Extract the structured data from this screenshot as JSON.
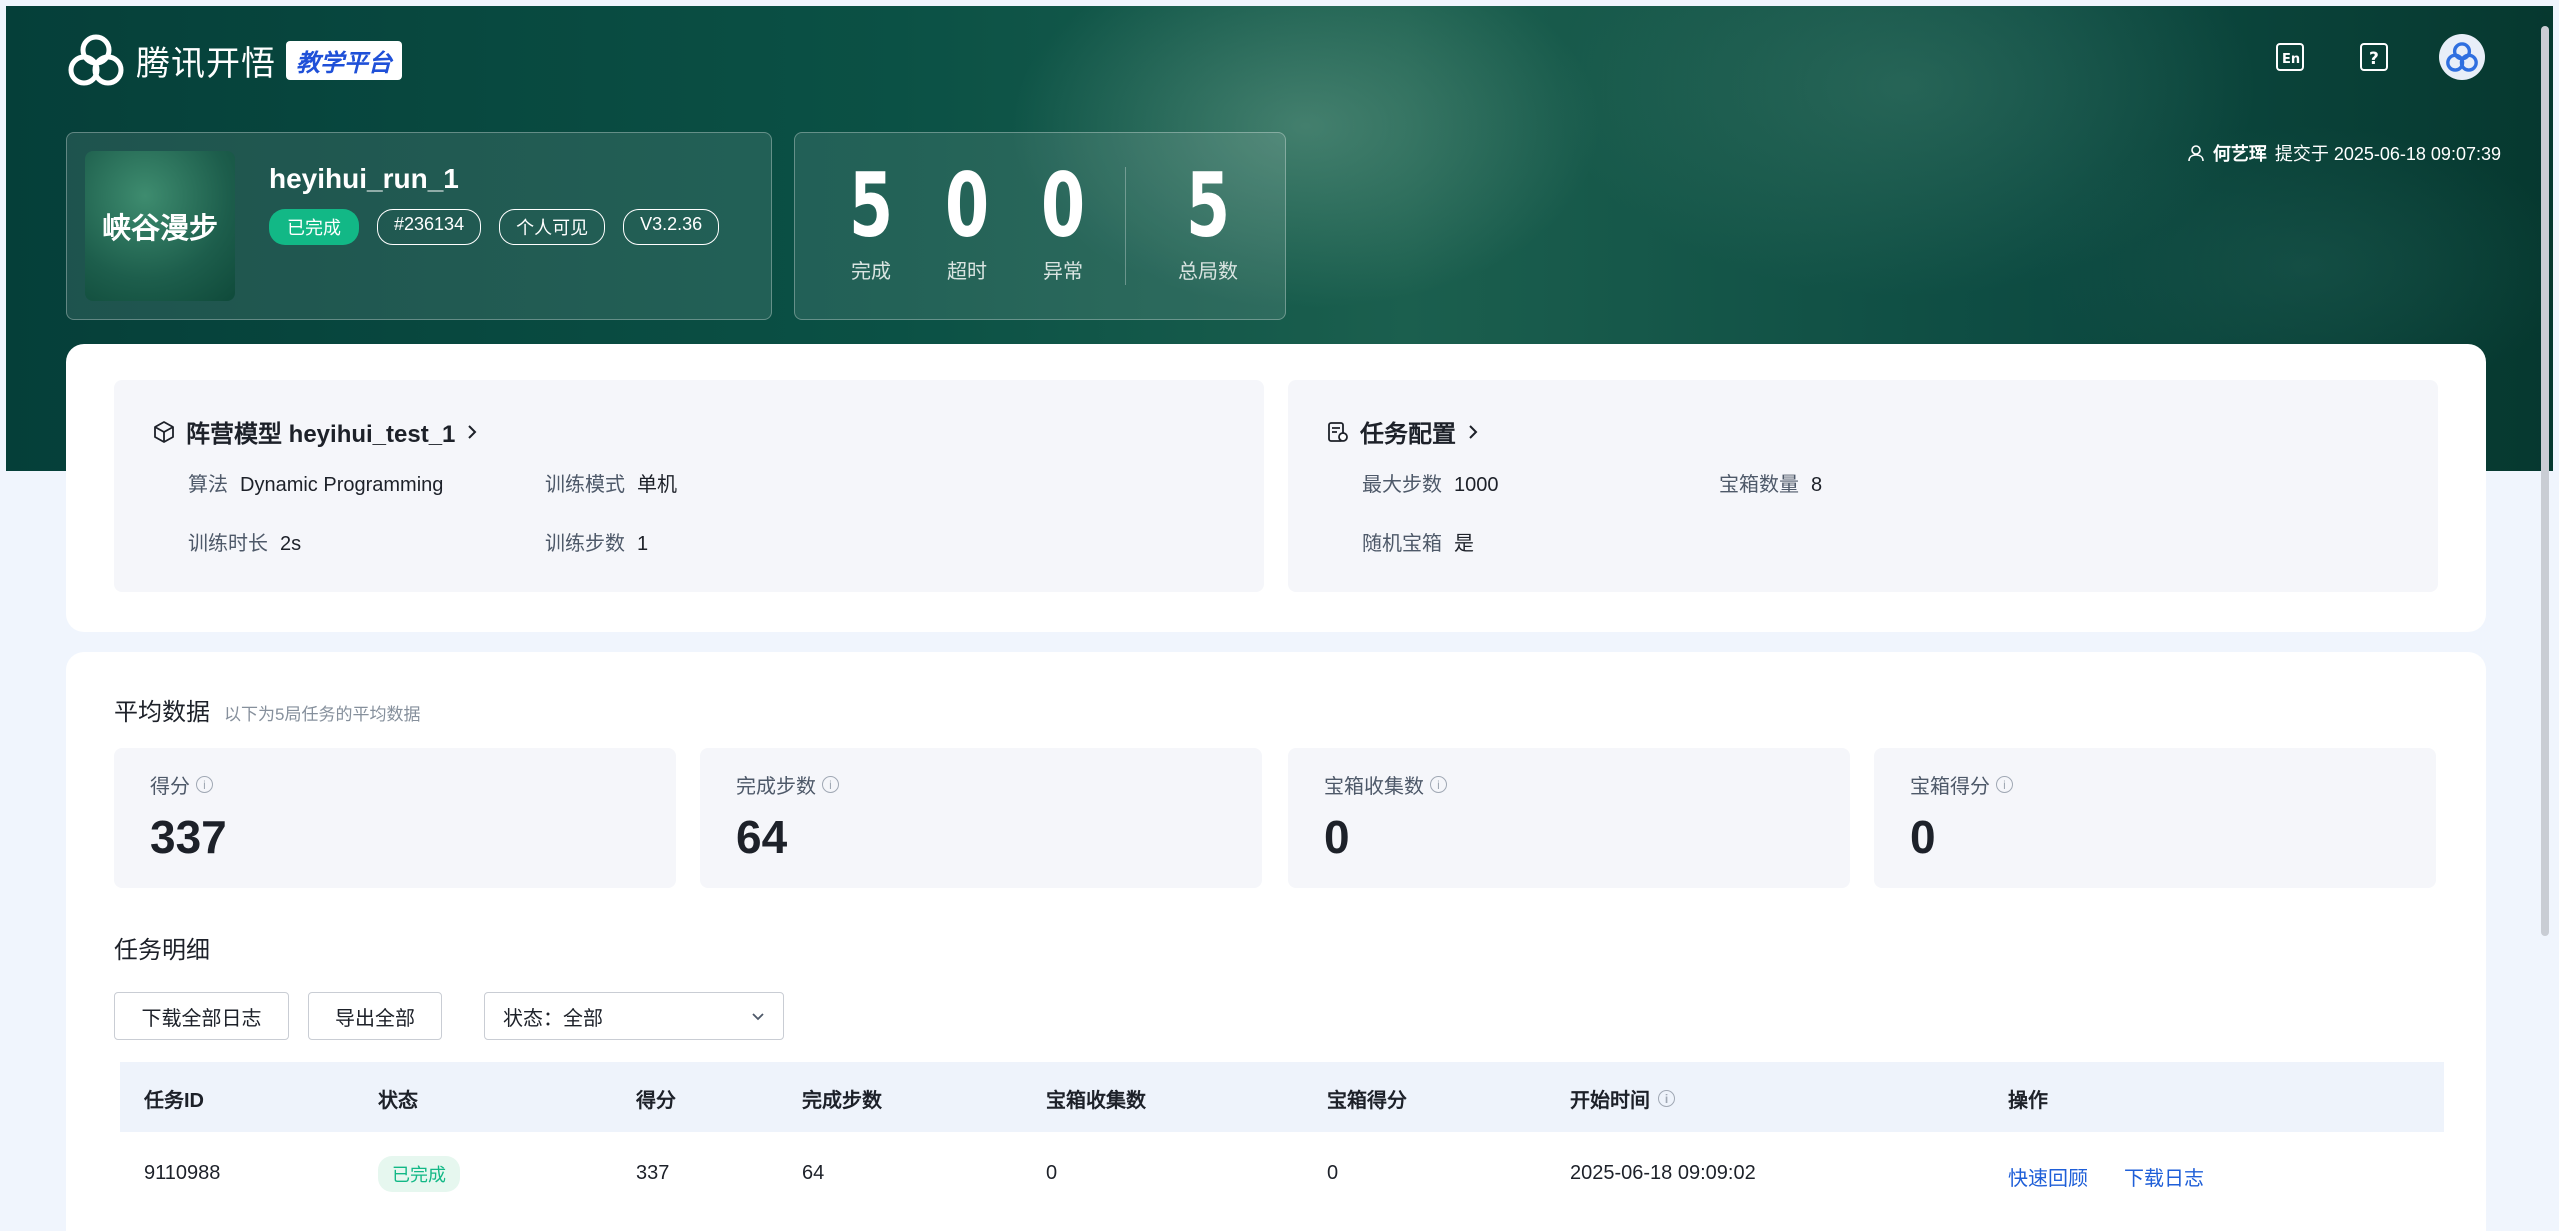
{
  "brand": {
    "name": "腾讯开悟",
    "tag": "教学平台"
  },
  "topbar": {
    "icons": [
      "language-en-icon",
      "help-icon",
      "user-avatar-icon"
    ]
  },
  "run": {
    "thumb_label": "峡谷漫步",
    "name": "heyihui_run_1",
    "status": "已完成",
    "id": "#236134",
    "visibility": "个人可见",
    "version": "V3.2.36"
  },
  "stats": [
    {
      "value": "5",
      "label": "完成"
    },
    {
      "value": "0",
      "label": "超时"
    },
    {
      "value": "0",
      "label": "异常"
    },
    {
      "value": "5",
      "label": "总局数"
    }
  ],
  "submitter": {
    "name": "何艺珲",
    "text": "提交于 2025-06-18 09:07:39"
  },
  "model_config": {
    "title": "阵营模型 heyihui_test_1",
    "items": [
      {
        "key": "算法",
        "value": "Dynamic Programming"
      },
      {
        "key": "训练模式",
        "value": "单机"
      },
      {
        "key": "训练时长",
        "value": "2s"
      },
      {
        "key": "训练步数",
        "value": "1"
      }
    ]
  },
  "task_config": {
    "title": "任务配置",
    "items": [
      {
        "key": "最大步数",
        "value": "1000"
      },
      {
        "key": "宝箱数量",
        "value": "8"
      },
      {
        "key": "随机宝箱",
        "value": "是"
      }
    ]
  },
  "averages": {
    "title": "平均数据",
    "subtitle": "以下为5局任务的平均数据",
    "cards": [
      {
        "label": "得分",
        "value": "337"
      },
      {
        "label": "完成步数",
        "value": "64"
      },
      {
        "label": "宝箱收集数",
        "value": "0"
      },
      {
        "label": "宝箱得分",
        "value": "0"
      }
    ]
  },
  "tasks": {
    "title": "任务明细",
    "buttons": {
      "download_all": "下载全部日志",
      "export_all": "导出全部"
    },
    "filter": {
      "label": "状态：",
      "value": "全部"
    },
    "columns": [
      "任务ID",
      "状态",
      "得分",
      "完成步数",
      "宝箱收集数",
      "宝箱得分",
      "开始时间",
      "操作"
    ],
    "rows": [
      {
        "id": "9110988",
        "status": "已完成",
        "score": "337",
        "steps": "64",
        "chests": "0",
        "chest_score": "0",
        "start": "2025-06-18 09:09:02",
        "actions": [
          "快速回顾",
          "下载日志"
        ]
      }
    ]
  }
}
